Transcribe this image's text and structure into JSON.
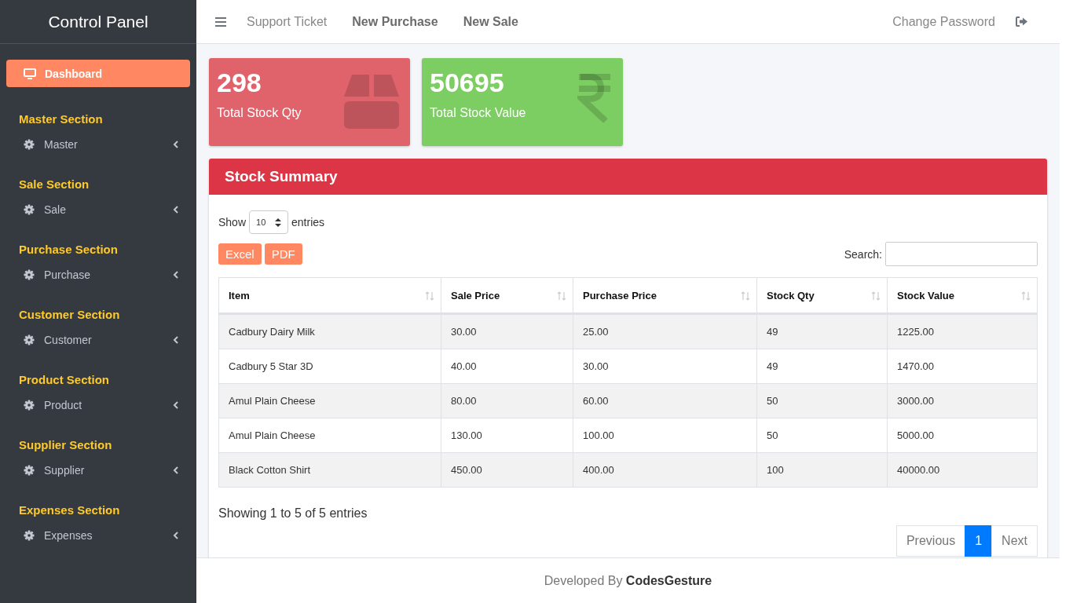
{
  "sidebar": {
    "title": "Control Panel",
    "dashboard": {
      "label": "Dashboard",
      "selected": true
    },
    "sections": [
      {
        "heading": "Master Section",
        "items": [
          {
            "label": "Master",
            "expanded": false
          }
        ]
      },
      {
        "heading": "Sale Section",
        "items": [
          {
            "label": "Sale",
            "expanded": false
          }
        ]
      },
      {
        "heading": "Purchase Section",
        "items": [
          {
            "label": "Purchase",
            "expanded": false
          }
        ]
      },
      {
        "heading": "Customer Section",
        "items": [
          {
            "label": "Customer",
            "expanded": false
          }
        ]
      },
      {
        "heading": "Product Section",
        "items": [
          {
            "label": "Product",
            "expanded": false
          }
        ]
      },
      {
        "heading": "Supplier Section",
        "items": [
          {
            "label": "Supplier",
            "expanded": false
          }
        ]
      },
      {
        "heading": "Expenses Section",
        "items": [
          {
            "label": "Expenses",
            "expanded": false
          }
        ]
      }
    ]
  },
  "topbar": {
    "links": [
      {
        "label": "Support Ticket",
        "bold": false
      },
      {
        "label": "New Purchase",
        "bold": true
      },
      {
        "label": "New Sale",
        "bold": true
      }
    ],
    "right_link": "Change Password"
  },
  "stat_cards": [
    {
      "value": "298",
      "label": "Total Stock Qty",
      "kind": "box",
      "color": "#e0636c"
    },
    {
      "value": "50695",
      "label": "Total Stock Value",
      "kind": "rupee",
      "color": "#7ccd62"
    }
  ],
  "panel": {
    "title": "Stock Summary",
    "length": {
      "before": "Show",
      "value": "10",
      "after": "entries"
    },
    "export_buttons": [
      "Excel",
      "PDF"
    ],
    "search": {
      "label": "Search:"
    },
    "table": {
      "columns": [
        "Item",
        "Sale Price",
        "Purchase Price",
        "Stock Qty",
        "Stock Value"
      ],
      "rows": [
        [
          "Cadbury Dairy Milk",
          "30.00",
          "25.00",
          "49",
          "1225.00"
        ],
        [
          "Cadbury 5 Star 3D",
          "40.00",
          "30.00",
          "49",
          "1470.00"
        ],
        [
          "Amul Plain Cheese",
          "80.00",
          "60.00",
          "50",
          "3000.00"
        ],
        [
          "Amul Plain Cheese",
          "130.00",
          "100.00",
          "50",
          "5000.00"
        ],
        [
          "Black Cotton Shirt",
          "450.00",
          "400.00",
          "100",
          "40000.00"
        ]
      ]
    },
    "info": "Showing 1 to 5 of 5 entries",
    "pagination": [
      {
        "label": "Previous",
        "selected": false
      },
      {
        "label": "1",
        "selected": true
      },
      {
        "label": "Next",
        "selected": false
      }
    ]
  },
  "footer": "Developed By **CodesGesture**"
}
